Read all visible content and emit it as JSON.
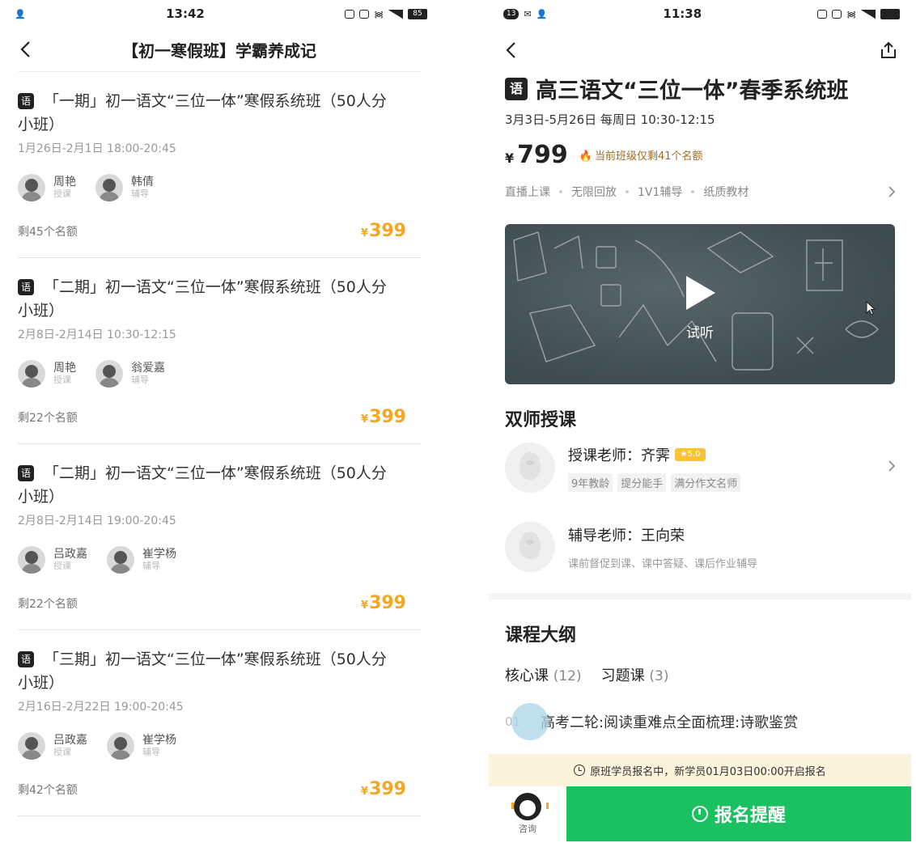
{
  "left": {
    "status": {
      "time": "13:42",
      "battery": "85"
    },
    "nav_title": "【初一寒假班】学霸养成记",
    "subject_badge": "语",
    "courses": [
      {
        "title": "「一期」初一语文“三位一体”寒假系统班（50人分小班）",
        "date": "1月26日-2月1日 18:00-20:45",
        "teachers": [
          {
            "name": "周艳",
            "role": "授课"
          },
          {
            "name": "韩倩",
            "role": "辅导"
          }
        ],
        "remain": "剩45个名额",
        "price": "399"
      },
      {
        "title": "「二期」初一语文“三位一体”寒假系统班（50人分小班）",
        "date": "2月8日-2月14日 10:30-12:15",
        "teachers": [
          {
            "name": "周艳",
            "role": "授课"
          },
          {
            "name": "翁爱嘉",
            "role": "辅导"
          }
        ],
        "remain": "剩22个名额",
        "price": "399"
      },
      {
        "title": "「二期」初一语文“三位一体”寒假系统班（50人分小班）",
        "date": "2月8日-2月14日 19:00-20:45",
        "teachers": [
          {
            "name": "吕政嘉",
            "role": "授课"
          },
          {
            "name": "崔学杨",
            "role": "辅导"
          }
        ],
        "remain": "剩22个名额",
        "price": "399"
      },
      {
        "title": "「三期」初一语文“三位一体”寒假系统班（50人分小班）",
        "date": "2月16日-2月22日 19:00-20:45",
        "teachers": [
          {
            "name": "吕政嘉",
            "role": "授课"
          },
          {
            "name": "崔学杨",
            "role": "辅导"
          }
        ],
        "remain": "剩42个名额",
        "price": "399"
      }
    ]
  },
  "right": {
    "status": {
      "time": "11:38",
      "badge": "13"
    },
    "subject_badge": "语",
    "title": "高三语文“三位一体”春季系统班",
    "date": "3月3日-5月26日 每周日 10:30-12:15",
    "currency": "¥",
    "price": "799",
    "remain": "当前班级仅剩41个名额",
    "features": [
      "直播上课",
      "无限回放",
      "1V1辅导",
      "纸质教材"
    ],
    "video_label": "试听",
    "teachers_section": "双师授课",
    "main_teacher": {
      "label": "授课老师：齐霁",
      "star": "★5.0",
      "tags": [
        "9年教龄",
        "提分能手",
        "满分作文名师"
      ]
    },
    "tutor": {
      "label": "辅导老师：王向荣",
      "desc": "课前督促到课、课中答疑、课后作业辅导"
    },
    "outline_section": "课程大纲",
    "tabs": [
      {
        "label": "核心课",
        "count": "(12)"
      },
      {
        "label": "习题课",
        "count": "(3)"
      }
    ],
    "outline_item": {
      "num": "01",
      "title": "高考二轮:阅读重难点全面梳理:诗歌鉴赏"
    },
    "notice": "原班学员报名中，新学员01月03日00:00开启报名",
    "consult_label": "咨询",
    "signup_label": "报名提醒"
  },
  "colors": {
    "price": "#f5a623",
    "primary_green": "#19c160",
    "notice_bg": "#fbf3dc"
  }
}
